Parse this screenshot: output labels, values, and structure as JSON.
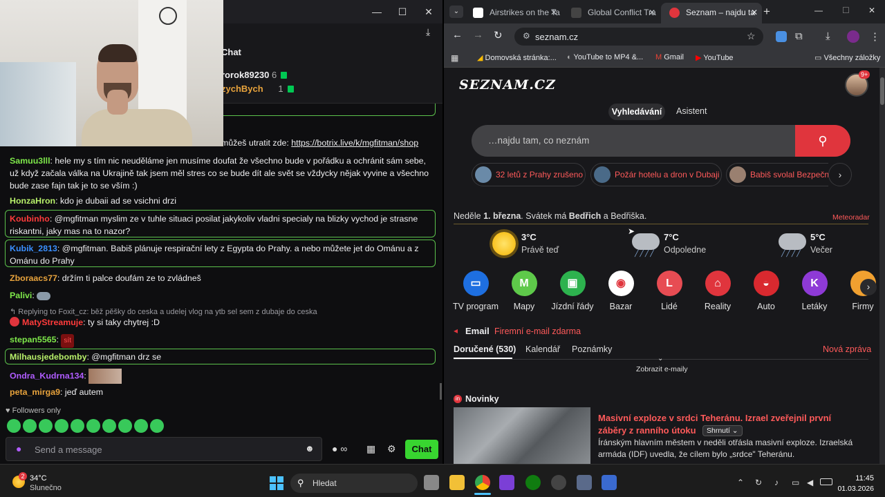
{
  "chat": {
    "header_title": "Chat",
    "leaderboard": [
      {
        "name": "rorok89230",
        "count": "6"
      },
      {
        "name": "zychBych",
        "count": "1"
      }
    ],
    "shop_text": "můžeš utratit zde: ",
    "shop_link": "https://botrix.live/k/mgfitman/shop",
    "messages": [
      {
        "user": "Samuu3lll",
        "text": ": hele my s tím nic neuděláme jen musíme doufat že všechno bude v pořádku a ochránit sám sebe, už když začala válka na Ukrajině tak jsem měl stres co se bude dít ale svět se vždycky nějak vyvine a všechno bude zase fajn tak je to se vším :)"
      },
      {
        "user": "HonzaHron",
        "text": ": kdo je dubaii ad se vsichni drzi"
      },
      {
        "user": "Koubinho",
        "text": ": @mgfitman myslim ze v tuhle situaci posilat jakykoliv vladni specialy na blizky vychod je strasne riskantni, jaky mas na to nazor?"
      },
      {
        "user": "Kubik_2813",
        "text": ": @mgfitman. Babiš plánuje respirační lety z Egypta do Prahy. a nebo můžete jet do Ománu a z Ománu do Prahy"
      },
      {
        "user": "Zboraacs77",
        "text": ": držím ti palce doufám ze to zvládneš"
      },
      {
        "user": "Palivi",
        "text": ":"
      },
      {
        "user": "MatyStreamuje",
        "text": ": ty si taky chytrej :D"
      },
      {
        "user": "stepan5565",
        "text": ":"
      },
      {
        "user": "Milhausjedebomby",
        "text": ": @mgfitman drz se"
      },
      {
        "user": "Ondra_Kudrna134",
        "text": ":"
      },
      {
        "user": "peta_mirga9",
        "text": ": jeď autem"
      }
    ],
    "reply_to": "Replying to Foxit_cz: běž pěšky do ceska a udelej vlog na ytb sel sem z dubaje do ceska",
    "sit_badge": "sít",
    "followers_only": "Followers only",
    "input_placeholder": "Send a message",
    "chat_button": "Chat"
  },
  "browser": {
    "tabs": [
      {
        "title": "Airstrikes on the Ta"
      },
      {
        "title": "Global Conflict Tra"
      },
      {
        "title": "Seznam – najdu ta"
      }
    ],
    "url": "seznam.cz",
    "bookmarks": [
      "Domovská stránka:...",
      "YouTube to MP4 &...",
      "Gmail",
      "YouTube",
      "Všechny záložky"
    ]
  },
  "seznam": {
    "logo": "SEZNAM.CZ",
    "avatar_badge": "9+",
    "search_tabs": [
      "Vyhledávání",
      "Asistent"
    ],
    "search_placeholder": "…najdu tam, co neznám",
    "chips": [
      "32 letů z Prahy zrušeno",
      "Požár hotelu a dron v Dubaji",
      "Babiš svolal Bezpečn"
    ],
    "date_prefix": "Neděle ",
    "date_bold": "1. března",
    "date_middle": ". Svátek má ",
    "date_name": "Bedřich",
    "date_suffix": " a Bedřiška.",
    "meteoradar": "Meteoradar",
    "weather": [
      {
        "temp": "3°C",
        "label": "Právě teď",
        "icon": "sun-icon"
      },
      {
        "temp": "7°C",
        "label": "Odpoledne",
        "icon": "rain-cloud-icon"
      },
      {
        "temp": "5°C",
        "label": "Večer",
        "icon": "rain-cloud-icon"
      }
    ],
    "services": [
      {
        "label": "TV program",
        "glyph": "📺",
        "color": "#1e6fe0"
      },
      {
        "label": "Mapy",
        "glyph": "M",
        "color": "#5ec94a"
      },
      {
        "label": "Jízdní řády",
        "glyph": "🚌",
        "color": "#2db24e"
      },
      {
        "label": "Bazar",
        "glyph": "◉",
        "color": "#ffffff"
      },
      {
        "label": "Lidé",
        "glyph": "L",
        "color": "#e74c53"
      },
      {
        "label": "Reality",
        "glyph": "⌂",
        "color": "#e0353d"
      },
      {
        "label": "Auto",
        "glyph": "🚗",
        "color": "#d9292f"
      },
      {
        "label": "Letáky",
        "glyph": "K",
        "color": "#8e3ad6"
      },
      {
        "label": "Firmy",
        "glyph": "",
        "color": "#f0a030"
      }
    ],
    "email_title": "Email",
    "email_promo": "Firemní e-mail zdarma",
    "email_tabs": [
      "Doručené (530)",
      "Kalendář",
      "Poznámky"
    ],
    "new_message": "Nová zpráva",
    "show_emails": "Zobrazit e-maily",
    "news_title": "Novinky",
    "article_title": "Masivní exploze v srdci Teheránu. Izrael zveřejnil první záběry z ranního útoku",
    "summary_btn": "Shrnutí",
    "article_text": "Íránským hlavním městem v neděli otřásla masivní exploze. Izraelská armáda (IDF) uvedla, že cílem bylo „srdce\" Teheránu."
  },
  "taskbar": {
    "weather_temp": "34°C",
    "weather_desc": "Slunečno",
    "weather_badge": "2",
    "search": "Hledat",
    "time": "11:45",
    "date": "01.03.2026"
  }
}
